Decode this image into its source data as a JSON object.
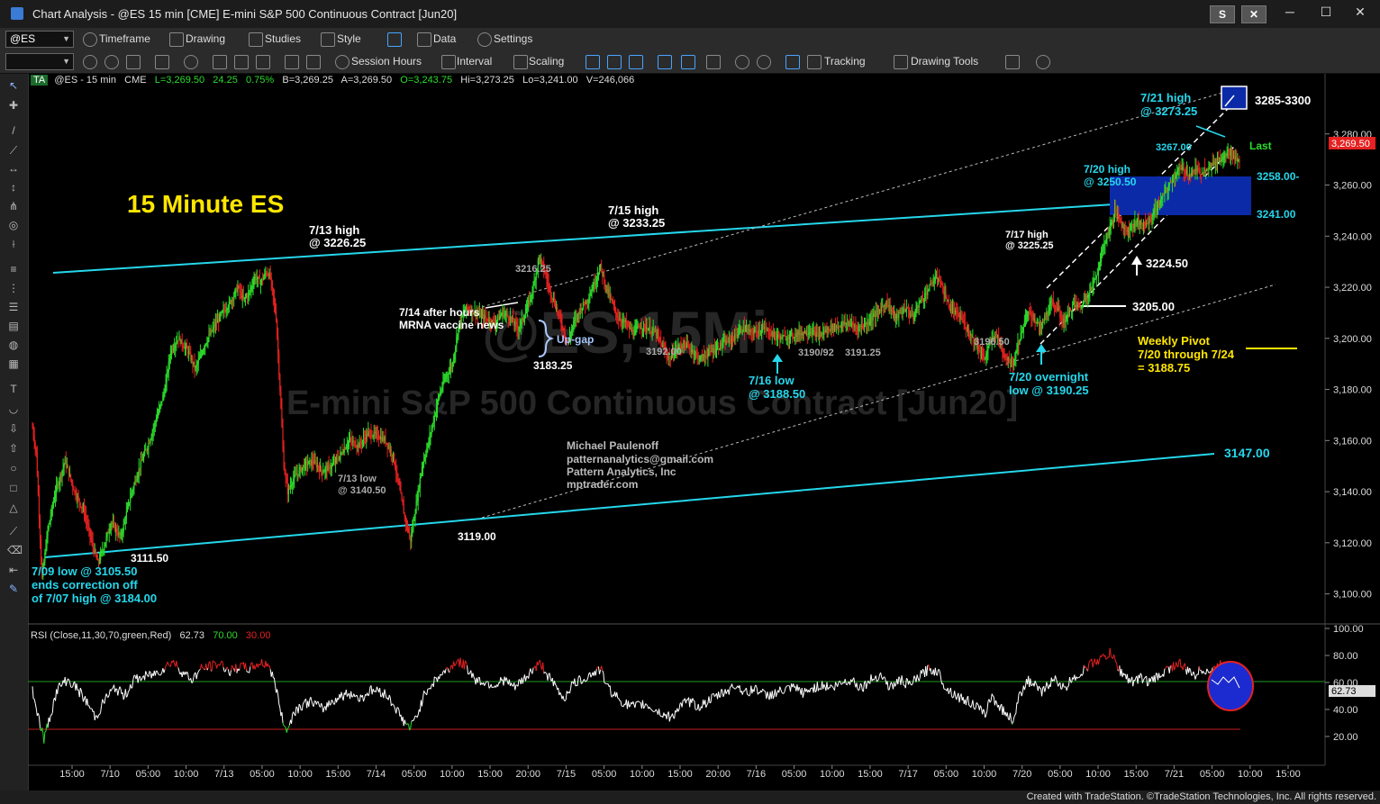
{
  "window": {
    "title": "Chart Analysis - @ES 15 min [CME] E-mini S&P 500 Continuous Contract [Jun20]",
    "btn_s": "S",
    "btn_x": "✕",
    "minimize": "─",
    "maximize": "☐",
    "close": "✕"
  },
  "toolbar1": {
    "symbol": "@ES",
    "timeframe": "Timeframe",
    "drawing": "Drawing",
    "studies": "Studies",
    "style": "Style",
    "data": "Data",
    "settings": "Settings"
  },
  "toolbar2": {
    "session_hours": "Session Hours",
    "interval": "Interval",
    "scaling": "Scaling",
    "tracking": "Tracking",
    "drawing_tools": "Drawing Tools"
  },
  "infobar": {
    "badge": "TA",
    "symbol": "@ES - 15 min",
    "exchange": "CME",
    "last": "L=3,269.50",
    "change": "24.25",
    "change_pct": "0.75%",
    "bid": "B=3,269.25",
    "ask": "A=3,269.50",
    "open": "O=3,243.75",
    "high": "Hi=3,273.25",
    "low": "Lo=3,241.00",
    "volume": "V=246,066"
  },
  "watermark": {
    "line1": "@ES,15Mi",
    "line2": "E-mini S&P 500 Continuous Contract [Jun20]"
  },
  "annotations": {
    "headline": "15 Minute ES",
    "h713a": "7/13 high",
    "h713b": "@ 3226.25",
    "h715a": "7/15 high",
    "h715b": "@ 3233.25",
    "h717a": "7/17 high",
    "h717b": "@ 3225.25",
    "h720a": "7/20 high",
    "h720b": "@ 3250.50",
    "h721a": "7/21 high",
    "h721b": "@ 3273.25",
    "target": "3285-3300",
    "p3267": "3267.00",
    "last": "Last",
    "p3258": "3258.00-",
    "p3241": "3241.00",
    "p3224": "3224.50",
    "p3205": "3205.00",
    "p3216": "3216.25",
    "mrna1": "7/14 after hours",
    "mrna2": "MRNA vaccine news",
    "upgap": "Up-gap",
    "p3183": "3183.25",
    "p3192": "3192.00",
    "l716a": "7/16 low",
    "l716b": "@ 3188.50",
    "p3190_92": "3190/92",
    "p3191": "3191.25",
    "p3196": "3196.50",
    "l720a": "7/20 overnight",
    "l720b": "low @ 3190.25",
    "wp1": "Weekly Pivot",
    "wp2": "7/20 through 7/24",
    "wp3": "= 3188.75",
    "p3147": "3147.00",
    "author1": "Michael Paulenoff",
    "author2": "patternanalytics@gmail.com",
    "author3": "Pattern Analytics, Inc",
    "author4": "mptrader.com",
    "l713a": "7/13 low",
    "l713b": "@ 3140.50",
    "p3119": "3119.00",
    "p3111": "3111.50",
    "l709a": "7/09 low @ 3105.50",
    "l709b": "ends correction off",
    "l709c": "of 7/07 high @ 3184.00"
  },
  "price_axis": {
    "ticks": [
      "3,280.00",
      "3,260.00",
      "3,240.00",
      "3,220.00",
      "3,200.00",
      "3,180.00",
      "3,160.00",
      "3,140.00",
      "3,120.00",
      "3,100.00"
    ],
    "last_tag": "3,269.50"
  },
  "rsi": {
    "title": "RSI (Close,11,30,70,green,Red)",
    "value": "62.73",
    "overbought": "70.00",
    "oversold": "30.00",
    "ticks": [
      "100.00",
      "80.00",
      "60.00",
      "40.00",
      "20.00"
    ],
    "last_tag": "62.73"
  },
  "time_axis": {
    "labels": [
      "15:00",
      "7/10",
      "05:00",
      "10:00",
      "7/13",
      "05:00",
      "10:00",
      "15:00",
      "7/14",
      "05:00",
      "10:00",
      "15:00",
      "20:00",
      "7/15",
      "05:00",
      "10:00",
      "15:00",
      "20:00",
      "7/16",
      "05:00",
      "10:00",
      "15:00",
      "7/17",
      "05:00",
      "10:00",
      "7/20",
      "05:00",
      "10:00",
      "15:00",
      "7/21",
      "05:00",
      "10:00",
      "15:00"
    ]
  },
  "status": {
    "credit": "Created with TradeStation. ©TradeStation Technologies, Inc. All rights reserved."
  },
  "chart_data": {
    "type": "candlestick",
    "ylim": [
      3090,
      3300
    ],
    "rsi_ylim": [
      0,
      100
    ],
    "path": [
      [
        0,
        3165
      ],
      [
        4,
        3155
      ],
      [
        10,
        3106
      ],
      [
        16,
        3125
      ],
      [
        24,
        3140
      ],
      [
        34,
        3152
      ],
      [
        44,
        3140
      ],
      [
        54,
        3132
      ],
      [
        62,
        3120
      ],
      [
        68,
        3112
      ],
      [
        74,
        3118
      ],
      [
        82,
        3128
      ],
      [
        92,
        3122
      ],
      [
        102,
        3138
      ],
      [
        112,
        3150
      ],
      [
        122,
        3160
      ],
      [
        132,
        3172
      ],
      [
        138,
        3180
      ],
      [
        144,
        3195
      ],
      [
        152,
        3200
      ],
      [
        162,
        3195
      ],
      [
        170,
        3188
      ],
      [
        180,
        3198
      ],
      [
        190,
        3205
      ],
      [
        198,
        3210
      ],
      [
        206,
        3214
      ],
      [
        214,
        3220
      ],
      [
        220,
        3215
      ],
      [
        226,
        3218
      ],
      [
        232,
        3224
      ],
      [
        238,
        3222
      ],
      [
        244,
        3226
      ],
      [
        248,
        3224
      ],
      [
        254,
        3208
      ],
      [
        258,
        3180
      ],
      [
        262,
        3150
      ],
      [
        266,
        3140
      ],
      [
        272,
        3145
      ],
      [
        282,
        3150
      ],
      [
        292,
        3152
      ],
      [
        302,
        3148
      ],
      [
        312,
        3150
      ],
      [
        320,
        3154
      ],
      [
        330,
        3160
      ],
      [
        340,
        3158
      ],
      [
        350,
        3163
      ],
      [
        360,
        3162
      ],
      [
        368,
        3160
      ],
      [
        376,
        3154
      ],
      [
        382,
        3142
      ],
      [
        388,
        3130
      ],
      [
        394,
        3121
      ],
      [
        400,
        3135
      ],
      [
        406,
        3150
      ],
      [
        412,
        3158
      ],
      [
        418,
        3168
      ],
      [
        424,
        3178
      ],
      [
        432,
        3186
      ],
      [
        438,
        3190
      ],
      [
        444,
        3205
      ],
      [
        452,
        3212
      ],
      [
        462,
        3210
      ],
      [
        472,
        3208
      ],
      [
        482,
        3206
      ],
      [
        490,
        3210
      ],
      [
        498,
        3208
      ],
      [
        506,
        3204
      ],
      [
        514,
        3210
      ],
      [
        522,
        3220
      ],
      [
        528,
        3232
      ],
      [
        534,
        3226
      ],
      [
        540,
        3218
      ],
      [
        546,
        3212
      ],
      [
        552,
        3205
      ],
      [
        558,
        3198
      ],
      [
        564,
        3206
      ],
      [
        572,
        3212
      ],
      [
        580,
        3216
      ],
      [
        586,
        3222
      ],
      [
        592,
        3228
      ],
      [
        598,
        3220
      ],
      [
        604,
        3214
      ],
      [
        610,
        3208
      ],
      [
        618,
        3206
      ],
      [
        626,
        3202
      ],
      [
        634,
        3205
      ],
      [
        642,
        3204
      ],
      [
        650,
        3202
      ],
      [
        658,
        3196
      ],
      [
        664,
        3192
      ],
      [
        672,
        3196
      ],
      [
        680,
        3198
      ],
      [
        688,
        3195
      ],
      [
        696,
        3192
      ],
      [
        704,
        3194
      ],
      [
        712,
        3196
      ],
      [
        720,
        3198
      ],
      [
        730,
        3200
      ],
      [
        740,
        3204
      ],
      [
        750,
        3202
      ],
      [
        760,
        3204
      ],
      [
        770,
        3202
      ],
      [
        780,
        3200
      ],
      [
        790,
        3201
      ],
      [
        800,
        3202
      ],
      [
        810,
        3203
      ],
      [
        820,
        3201
      ],
      [
        830,
        3204
      ],
      [
        840,
        3205
      ],
      [
        850,
        3206
      ],
      [
        860,
        3204
      ],
      [
        870,
        3206
      ],
      [
        880,
        3210
      ],
      [
        890,
        3214
      ],
      [
        900,
        3208
      ],
      [
        910,
        3212
      ],
      [
        918,
        3208
      ],
      [
        924,
        3214
      ],
      [
        932,
        3218
      ],
      [
        938,
        3222
      ],
      [
        944,
        3224
      ],
      [
        950,
        3218
      ],
      [
        956,
        3212
      ],
      [
        962,
        3210
      ],
      [
        968,
        3208
      ],
      [
        974,
        3204
      ],
      [
        980,
        3200
      ],
      [
        986,
        3196
      ],
      [
        992,
        3192
      ],
      [
        998,
        3198
      ],
      [
        1004,
        3202
      ],
      [
        1010,
        3196
      ],
      [
        1016,
        3192
      ],
      [
        1022,
        3190
      ],
      [
        1026,
        3196
      ],
      [
        1032,
        3204
      ],
      [
        1038,
        3210
      ],
      [
        1044,
        3208
      ],
      [
        1050,
        3204
      ],
      [
        1056,
        3209
      ],
      [
        1062,
        3214
      ],
      [
        1068,
        3212
      ],
      [
        1074,
        3206
      ],
      [
        1080,
        3210
      ],
      [
        1086,
        3214
      ],
      [
        1092,
        3212
      ],
      [
        1098,
        3216
      ],
      [
        1104,
        3220
      ],
      [
        1110,
        3226
      ],
      [
        1116,
        3236
      ],
      [
        1122,
        3242
      ],
      [
        1128,
        3250
      ],
      [
        1134,
        3246
      ],
      [
        1140,
        3242
      ],
      [
        1146,
        3244
      ],
      [
        1152,
        3246
      ],
      [
        1158,
        3244
      ],
      [
        1164,
        3246
      ],
      [
        1170,
        3250
      ],
      [
        1176,
        3254
      ],
      [
        1182,
        3258
      ],
      [
        1188,
        3262
      ],
      [
        1194,
        3266
      ],
      [
        1200,
        3266
      ],
      [
        1206,
        3264
      ],
      [
        1212,
        3266
      ],
      [
        1218,
        3265
      ],
      [
        1224,
        3267
      ],
      [
        1230,
        3268
      ],
      [
        1236,
        3270
      ],
      [
        1242,
        3272
      ],
      [
        1246,
        3273
      ],
      [
        1250,
        3272
      ],
      [
        1254,
        3270
      ],
      [
        1258,
        3269
      ]
    ],
    "rsi_path": [
      [
        0,
        55
      ],
      [
        6,
        35
      ],
      [
        12,
        18
      ],
      [
        18,
        34
      ],
      [
        26,
        55
      ],
      [
        36,
        62
      ],
      [
        46,
        56
      ],
      [
        56,
        46
      ],
      [
        66,
        34
      ],
      [
        76,
        48
      ],
      [
        86,
        56
      ],
      [
        96,
        50
      ],
      [
        106,
        62
      ],
      [
        116,
        64
      ],
      [
        126,
        66
      ],
      [
        136,
        70
      ],
      [
        146,
        76
      ],
      [
        156,
        68
      ],
      [
        166,
        62
      ],
      [
        176,
        70
      ],
      [
        186,
        72
      ],
      [
        196,
        74
      ],
      [
        206,
        68
      ],
      [
        216,
        72
      ],
      [
        226,
        70
      ],
      [
        236,
        74
      ],
      [
        246,
        74
      ],
      [
        254,
        56
      ],
      [
        260,
        34
      ],
      [
        266,
        24
      ],
      [
        272,
        38
      ],
      [
        282,
        44
      ],
      [
        292,
        46
      ],
      [
        302,
        40
      ],
      [
        312,
        46
      ],
      [
        322,
        50
      ],
      [
        332,
        52
      ],
      [
        342,
        48
      ],
      [
        352,
        54
      ],
      [
        362,
        54
      ],
      [
        370,
        50
      ],
      [
        378,
        42
      ],
      [
        386,
        32
      ],
      [
        394,
        26
      ],
      [
        402,
        38
      ],
      [
        410,
        54
      ],
      [
        418,
        60
      ],
      [
        426,
        66
      ],
      [
        434,
        70
      ],
      [
        442,
        76
      ],
      [
        452,
        72
      ],
      [
        462,
        62
      ],
      [
        472,
        60
      ],
      [
        482,
        58
      ],
      [
        492,
        62
      ],
      [
        502,
        56
      ],
      [
        512,
        62
      ],
      [
        522,
        70
      ],
      [
        530,
        74
      ],
      [
        538,
        64
      ],
      [
        546,
        56
      ],
      [
        554,
        48
      ],
      [
        562,
        58
      ],
      [
        572,
        62
      ],
      [
        582,
        66
      ],
      [
        592,
        70
      ],
      [
        600,
        56
      ],
      [
        608,
        50
      ],
      [
        618,
        44
      ],
      [
        628,
        42
      ],
      [
        638,
        44
      ],
      [
        648,
        40
      ],
      [
        658,
        36
      ],
      [
        666,
        34
      ],
      [
        674,
        42
      ],
      [
        684,
        46
      ],
      [
        694,
        42
      ],
      [
        704,
        46
      ],
      [
        714,
        50
      ],
      [
        724,
        54
      ],
      [
        734,
        58
      ],
      [
        744,
        52
      ],
      [
        754,
        56
      ],
      [
        764,
        50
      ],
      [
        774,
        52
      ],
      [
        784,
        54
      ],
      [
        794,
        56
      ],
      [
        804,
        52
      ],
      [
        814,
        56
      ],
      [
        824,
        58
      ],
      [
        834,
        56
      ],
      [
        844,
        60
      ],
      [
        854,
        62
      ],
      [
        864,
        56
      ],
      [
        874,
        62
      ],
      [
        884,
        66
      ],
      [
        894,
        56
      ],
      [
        904,
        62
      ],
      [
        914,
        58
      ],
      [
        924,
        64
      ],
      [
        934,
        70
      ],
      [
        944,
        68
      ],
      [
        952,
        56
      ],
      [
        960,
        52
      ],
      [
        968,
        48
      ],
      [
        976,
        46
      ],
      [
        984,
        42
      ],
      [
        992,
        36
      ],
      [
        1000,
        50
      ],
      [
        1008,
        42
      ],
      [
        1016,
        36
      ],
      [
        1022,
        32
      ],
      [
        1028,
        48
      ],
      [
        1036,
        62
      ],
      [
        1044,
        58
      ],
      [
        1052,
        52
      ],
      [
        1060,
        60
      ],
      [
        1068,
        62
      ],
      [
        1076,
        54
      ],
      [
        1084,
        64
      ],
      [
        1092,
        66
      ],
      [
        1100,
        72
      ],
      [
        1108,
        76
      ],
      [
        1116,
        78
      ],
      [
        1124,
        82
      ],
      [
        1132,
        70
      ],
      [
        1140,
        64
      ],
      [
        1148,
        60
      ],
      [
        1156,
        64
      ],
      [
        1164,
        60
      ],
      [
        1172,
        64
      ],
      [
        1180,
        68
      ],
      [
        1188,
        72
      ],
      [
        1196,
        74
      ],
      [
        1204,
        68
      ],
      [
        1212,
        66
      ],
      [
        1220,
        70
      ],
      [
        1228,
        68
      ],
      [
        1236,
        72
      ],
      [
        1244,
        74
      ],
      [
        1250,
        70
      ],
      [
        1254,
        64
      ],
      [
        1258,
        63
      ]
    ]
  }
}
